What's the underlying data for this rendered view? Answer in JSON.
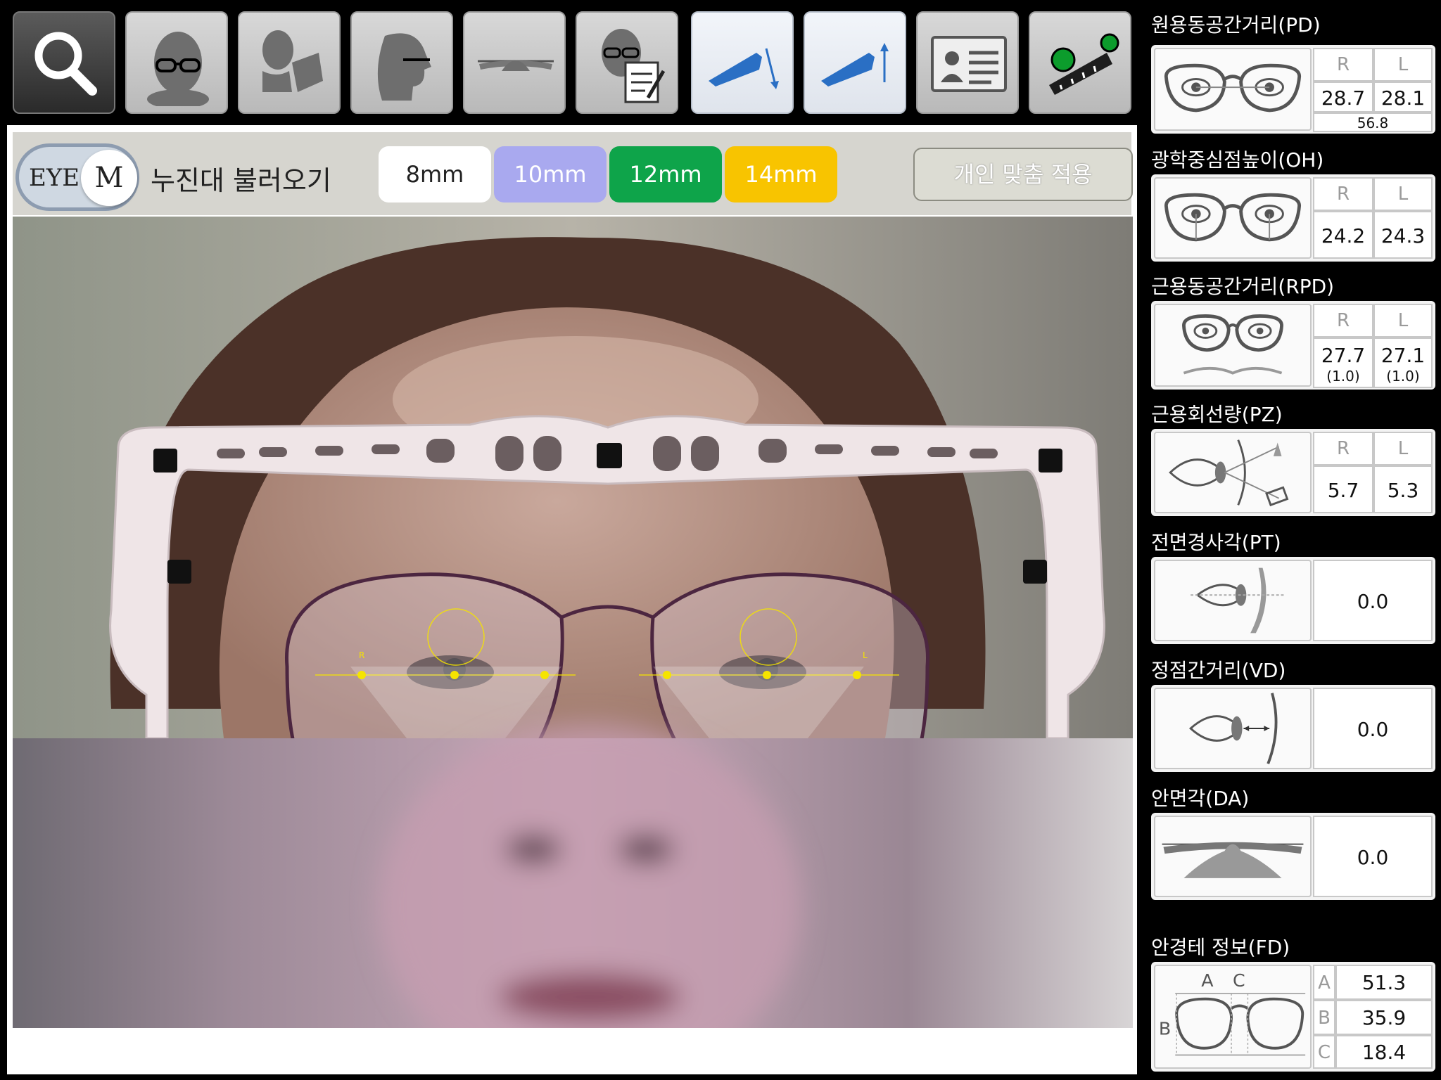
{
  "toolbar": {
    "buttons": [
      {
        "name": "search",
        "icon": "search-icon"
      },
      {
        "name": "face-front",
        "icon": "face-glasses-icon"
      },
      {
        "name": "face-reading",
        "icon": "face-reading-icon"
      },
      {
        "name": "face-side",
        "icon": "face-side-icon"
      },
      {
        "name": "frame-wrap",
        "icon": "frame-wrap-icon"
      },
      {
        "name": "face-document",
        "icon": "face-document-icon"
      },
      {
        "name": "lens-down",
        "icon": "lens-arrow-down-icon"
      },
      {
        "name": "lens-up",
        "icon": "lens-arrow-up-icon"
      },
      {
        "name": "id-card",
        "icon": "id-card-icon"
      },
      {
        "name": "ruler-calibrate",
        "icon": "ruler-icon"
      }
    ]
  },
  "subbar": {
    "eye_text": "EYE",
    "eye_mode": "M",
    "load_label": "누진대 불러오기",
    "mm_options": [
      {
        "label": "8mm",
        "bg": "#ffffff",
        "color": "#222222"
      },
      {
        "label": "10mm",
        "bg": "#a9a9ef",
        "color": "#ffffff"
      },
      {
        "label": "12mm",
        "bg": "#0ea44a",
        "color": "#ffffff"
      },
      {
        "label": "14mm",
        "bg": "#f8c400",
        "color": "#ffffff"
      }
    ],
    "apply_label": "개인 맞춤 적용"
  },
  "overlay": {
    "right_eye_label": "R",
    "left_eye_label": "L"
  },
  "panel": {
    "pd": {
      "title": "원용동공간거리(PD)",
      "r_label": "R",
      "l_label": "L",
      "r": "28.7",
      "l": "28.1",
      "total": "56.8"
    },
    "oh": {
      "title": "광학중심점높이(OH)",
      "r_label": "R",
      "l_label": "L",
      "r": "24.2",
      "l": "24.3"
    },
    "rpd": {
      "title": "근용동공간거리(RPD)",
      "r_label": "R",
      "l_label": "L",
      "r": "27.7",
      "l": "27.1",
      "r_sub": "(1.0)",
      "l_sub": "(1.0)"
    },
    "pz": {
      "title": "근용회선량(PZ)",
      "r_label": "R",
      "l_label": "L",
      "r": "5.7",
      "l": "5.3"
    },
    "pt": {
      "title": "전면경사각(PT)",
      "value": "0.0"
    },
    "vd": {
      "title": "정점간거리(VD)",
      "value": "0.0"
    },
    "da": {
      "title": "안면각(DA)",
      "value": "0.0"
    },
    "fd": {
      "title": "안경테 정보(FD)",
      "a_label": "A",
      "b_label": "B",
      "c_label": "C",
      "a": "51.3",
      "b": "35.9",
      "c": "18.4"
    }
  },
  "colors": {
    "accent_yellow": "#f5e400",
    "lens_blue": "#2a6fc4",
    "ruler_green": "#0c9c2c"
  }
}
